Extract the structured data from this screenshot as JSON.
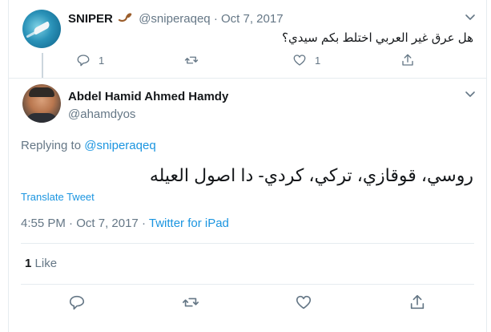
{
  "parent_tweet": {
    "display_name": "SNIPER",
    "handle": "@sniperaqeq",
    "separator": "·",
    "date": "Oct 7, 2017",
    "text": "هل عرق غير العربي اختلط بكم سيدي؟",
    "actions": {
      "reply_count": "1",
      "retweet_count": "",
      "like_count": "1"
    }
  },
  "main_tweet": {
    "display_name": "Abdel Hamid Ahmed Hamdy",
    "handle": "@ahamdyos",
    "replying_prefix": "Replying to",
    "replying_to": "@sniperaqeq",
    "text": "روسي، قوقازي، تركي، كردي- دا اصول العيله",
    "translate_label": "Translate Tweet",
    "time": "4:55 PM",
    "separator1": "·",
    "date": "Oct 7, 2017",
    "separator2": "·",
    "source": "Twitter for iPad",
    "like_count": "1",
    "like_label": "Like"
  },
  "icons": {
    "reply": "reply-icon",
    "retweet": "retweet-icon",
    "like": "heart-icon",
    "share": "share-icon",
    "menu": "chevron-down-icon"
  },
  "colors": {
    "link": "#1b95e0",
    "muted": "#657786",
    "text": "#14171a",
    "border": "#e6ecf0"
  }
}
